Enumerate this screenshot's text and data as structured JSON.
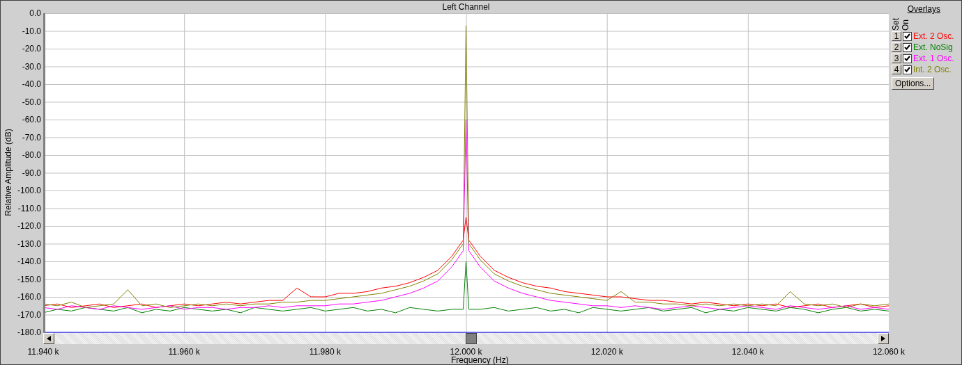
{
  "plot": {
    "chart_data": {
      "type": "line",
      "title": "Left Channel",
      "xlabel": "Frequency (Hz)",
      "ylabel": "Relative Amplitude (dB)",
      "x": [
        11.94,
        11.942,
        11.944,
        11.946,
        11.948,
        11.95,
        11.952,
        11.954,
        11.956,
        11.958,
        11.96,
        11.962,
        11.964,
        11.966,
        11.968,
        11.97,
        11.972,
        11.974,
        11.976,
        11.978,
        11.98,
        11.982,
        11.984,
        11.986,
        11.988,
        11.99,
        11.992,
        11.994,
        11.996,
        11.998,
        11.9996,
        12.0,
        12.0004,
        12.002,
        12.004,
        12.006,
        12.008,
        12.01,
        12.012,
        12.014,
        12.016,
        12.018,
        12.02,
        12.022,
        12.024,
        12.026,
        12.028,
        12.03,
        12.032,
        12.034,
        12.036,
        12.038,
        12.04,
        12.042,
        12.044,
        12.046,
        12.048,
        12.05,
        12.052,
        12.054,
        12.056,
        12.058,
        12.06
      ],
      "series": [
        {
          "name": "Ext. 2 Osc.",
          "color": "#ff0000",
          "values": [
            -165,
            -164,
            -166,
            -165,
            -164,
            -166,
            -165,
            -164,
            -166,
            -165,
            -164,
            -165,
            -164,
            -163,
            -164,
            -163,
            -162,
            -162,
            -155,
            -160,
            -160,
            -158,
            -158,
            -157,
            -155,
            -154,
            -152,
            -149,
            -145,
            -137,
            -128,
            -115,
            -128,
            -137,
            -145,
            -149,
            -152,
            -154,
            -155,
            -157,
            -158,
            -159,
            -160,
            -160,
            -161,
            -162,
            -162,
            -163,
            -164,
            -163,
            -164,
            -165,
            -164,
            -165,
            -164,
            -166,
            -165,
            -164,
            -166,
            -165,
            -164,
            -166,
            -165
          ]
        },
        {
          "name": "Ext. NoSig",
          "color": "#008000",
          "values": [
            -169,
            -167,
            -168,
            -166,
            -167,
            -168,
            -166,
            -169,
            -167,
            -168,
            -166,
            -167,
            -168,
            -167,
            -169,
            -166,
            -167,
            -168,
            -167,
            -166,
            -168,
            -167,
            -166,
            -168,
            -167,
            -169,
            -166,
            -167,
            -168,
            -167,
            -167,
            -140,
            -167,
            -167,
            -166,
            -168,
            -167,
            -166,
            -168,
            -167,
            -169,
            -166,
            -167,
            -168,
            -167,
            -166,
            -168,
            -167,
            -166,
            -169,
            -167,
            -168,
            -166,
            -167,
            -168,
            -166,
            -167,
            -169,
            -167,
            -166,
            -168,
            -167,
            -168
          ]
        },
        {
          "name": "Ext. 1 Osc.",
          "color": "#ff00ff",
          "values": [
            -166,
            -167,
            -165,
            -166,
            -167,
            -165,
            -166,
            -167,
            -166,
            -165,
            -167,
            -166,
            -166,
            -167,
            -166,
            -166,
            -165,
            -166,
            -165,
            -165,
            -165,
            -164,
            -164,
            -163,
            -162,
            -160,
            -158,
            -155,
            -151,
            -143,
            -134,
            -60,
            -134,
            -143,
            -151,
            -155,
            -158,
            -160,
            -162,
            -163,
            -164,
            -165,
            -165,
            -166,
            -165,
            -166,
            -167,
            -166,
            -165,
            -166,
            -167,
            -166,
            -165,
            -166,
            -167,
            -165,
            -166,
            -167,
            -166,
            -165,
            -167,
            -166,
            -167
          ]
        },
        {
          "name": "Int. 2 Osc.",
          "color": "#808000",
          "values": [
            -164,
            -165,
            -163,
            -166,
            -165,
            -164,
            -156,
            -165,
            -164,
            -166,
            -165,
            -164,
            -165,
            -164,
            -165,
            -164,
            -164,
            -163,
            -163,
            -162,
            -162,
            -161,
            -160,
            -159,
            -158,
            -156,
            -154,
            -151,
            -147,
            -139,
            -130,
            -7,
            -130,
            -139,
            -147,
            -151,
            -154,
            -156,
            -158,
            -159,
            -160,
            -161,
            -162,
            -157,
            -163,
            -163,
            -164,
            -164,
            -165,
            -164,
            -165,
            -164,
            -165,
            -164,
            -165,
            -157,
            -164,
            -165,
            -164,
            -166,
            -164,
            -165,
            -164
          ]
        }
      ],
      "xlim": [
        11.94,
        12.06
      ],
      "ylim": [
        -180,
        0
      ],
      "grid": true,
      "xticks": [
        {
          "value": 11.94,
          "label": "11.940 k"
        },
        {
          "value": 11.96,
          "label": "11.960 k"
        },
        {
          "value": 11.98,
          "label": "11.980 k"
        },
        {
          "value": 12.0,
          "label": "12.000 k"
        },
        {
          "value": 12.02,
          "label": "12.020 k"
        },
        {
          "value": 12.04,
          "label": "12.040 k"
        },
        {
          "value": 12.06,
          "label": "12.060 k"
        }
      ],
      "yticks": [
        {
          "value": 0,
          "label": "0.0"
        },
        {
          "value": -10,
          "label": "-10.0"
        },
        {
          "value": -20,
          "label": "-20.0"
        },
        {
          "value": -30,
          "label": "-30.0"
        },
        {
          "value": -40,
          "label": "-40.0"
        },
        {
          "value": -50,
          "label": "-50.0"
        },
        {
          "value": -60,
          "label": "-60.0"
        },
        {
          "value": -70,
          "label": "-70.0"
        },
        {
          "value": -80,
          "label": "-80.0"
        },
        {
          "value": -90,
          "label": "-90.0"
        },
        {
          "value": -100,
          "label": "-100.0"
        },
        {
          "value": -110,
          "label": "-110.0"
        },
        {
          "value": -120,
          "label": "-120.0"
        },
        {
          "value": -130,
          "label": "-130.0"
        },
        {
          "value": -140,
          "label": "-140.0"
        },
        {
          "value": -150,
          "label": "-150.0"
        },
        {
          "value": -160,
          "label": "-160.0"
        },
        {
          "value": -170,
          "label": "-170.0"
        },
        {
          "value": -180,
          "label": "-180.0"
        }
      ]
    }
  },
  "overlays": {
    "title": "Overlays",
    "set_header": "Set",
    "on_header": "On",
    "items": [
      {
        "set": "1",
        "on": true
      },
      {
        "set": "2",
        "on": true
      },
      {
        "set": "3",
        "on": true
      },
      {
        "set": "4",
        "on": true
      }
    ],
    "options_button": "Options..."
  }
}
